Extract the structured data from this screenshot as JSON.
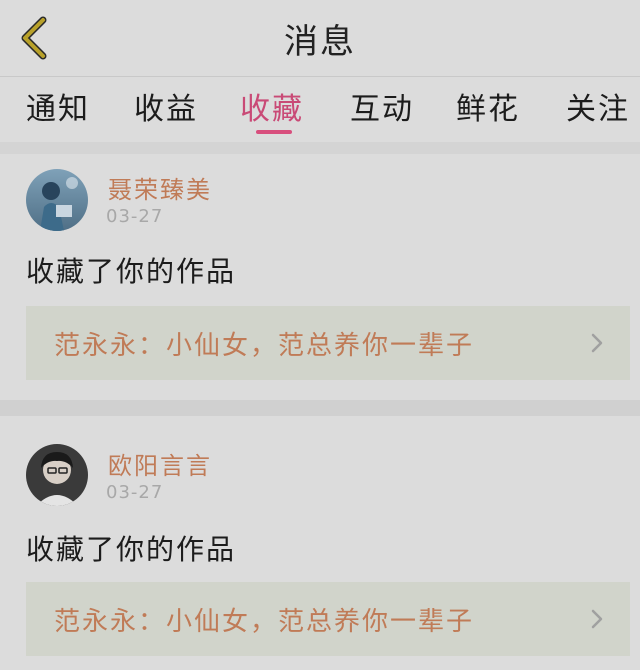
{
  "header": {
    "title": "消息",
    "back_icon": "chevron-left-icon"
  },
  "tabs": [
    {
      "label": "通知",
      "active": false
    },
    {
      "label": "收益",
      "active": false
    },
    {
      "label": "收藏",
      "active": true
    },
    {
      "label": "互动",
      "active": false
    },
    {
      "label": "鲜花",
      "active": false
    },
    {
      "label": "关注",
      "active": false
    }
  ],
  "messages": [
    {
      "user_name": "聂荣臻美",
      "date": "03-27",
      "action": "收藏了你的作品",
      "work_title": "范永永：小仙女，范总养你一辈子"
    },
    {
      "user_name": "欧阳言言",
      "date": "03-27",
      "action": "收藏了你的作品",
      "work_title": "范永永：小仙女，范总养你一辈子"
    }
  ],
  "colors": {
    "accent": "#d84f7d",
    "name": "#c07b57",
    "background": "#dcdcdc",
    "back_icon": "#b8a12a"
  }
}
